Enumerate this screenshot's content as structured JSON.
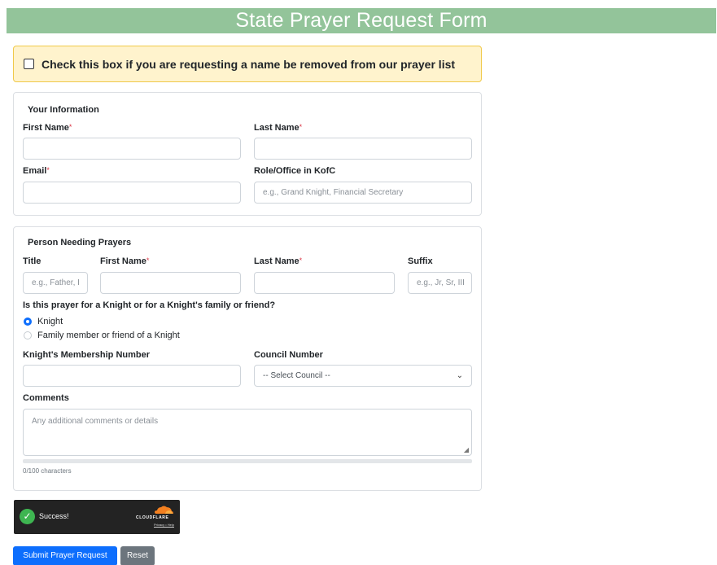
{
  "page": {
    "title": "State Prayer Request Form"
  },
  "removal": {
    "label": "Check this box if you are requesting a name be removed from our prayer list",
    "checked": false
  },
  "your_info": {
    "title": "Your Information",
    "first_name_label": "First Name",
    "last_name_label": "Last Name",
    "email_label": "Email",
    "role_label": "Role/Office in KofC",
    "role_placeholder": "e.g., Grand Knight, Financial Secretary",
    "required_mark": "*"
  },
  "person": {
    "title": "Person Needing Prayers",
    "title_label": "Title",
    "title_placeholder": "e.g., Father, I",
    "first_name_label": "First Name",
    "last_name_label": "Last Name",
    "suffix_label": "Suffix",
    "suffix_placeholder": "e.g., Jr, Sr, III",
    "question": "Is this prayer for a Knight or for a Knight's family or friend?",
    "options": [
      {
        "label": "Knight",
        "selected": true
      },
      {
        "label": "Family member or friend of a Knight",
        "selected": false
      }
    ],
    "membership_label": "Knight's Membership Number",
    "council_label": "Council Number",
    "council_selected": "-- Select Council --",
    "comments_label": "Comments",
    "comments_placeholder": "Any additional comments or details",
    "char_count": "0/100 characters"
  },
  "captcha": {
    "status": "Success!",
    "brand": "CLOUDFLARE",
    "links": "Privacy • Help"
  },
  "buttons": {
    "submit": "Submit Prayer Request",
    "reset": "Reset"
  },
  "colors": {
    "title_bar": "#93c49a",
    "alert_bg": "#fff3cd",
    "primary": "#0d6efd",
    "secondary": "#6c757d",
    "required": "#dc3545",
    "success": "#3eb551"
  }
}
